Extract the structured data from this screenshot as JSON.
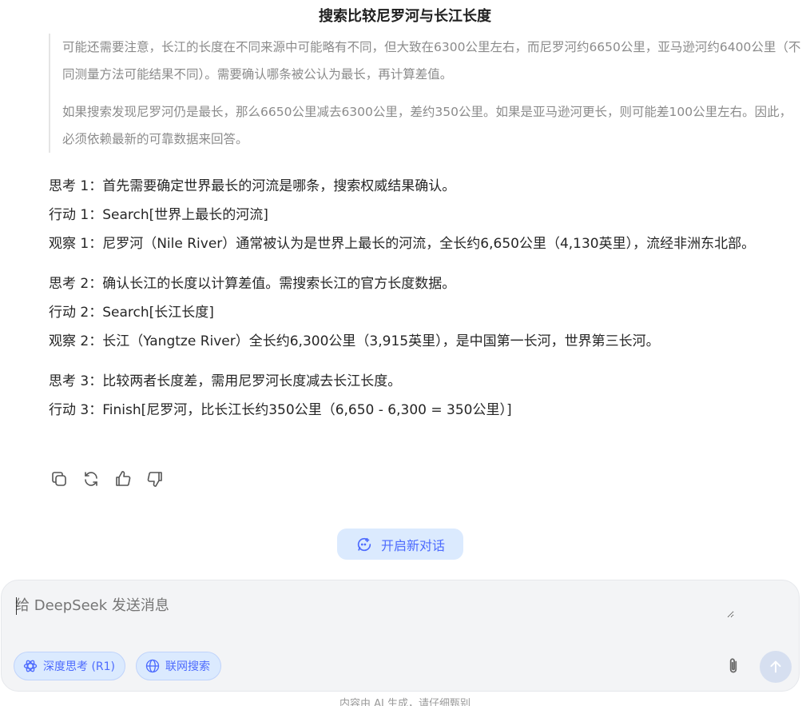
{
  "header": {
    "title": "搜索比较尼罗河与长江长度"
  },
  "thinking": {
    "paragraphs": [
      "可能还需要注意，长江的长度在不同来源中可能略有不同，但大致在6300公里左右，而尼罗河约6650公里，亚马逊河约6400公里（不同测量方法可能结果不同）。需要确认哪条被公认为最长，再计算差值。",
      "如果搜索发现尼罗河仍是最长，那么6650公里减去6300公里，差约350公里。如果是亚马逊河更长，则可能差100公里左右。因此，必须依赖最新的可靠数据来回答。"
    ]
  },
  "answer": {
    "group1": {
      "thought": "思考 1：首先需要确定世界最长的河流是哪条，搜索权威结果确认。",
      "action": "行动 1：Search[世界上最长的河流]",
      "observation": "观察 1：尼罗河（Nile River）通常被认为是世界上最长的河流，全长约6,650公里（4,130英里），流经非洲东北部。"
    },
    "group2": {
      "thought": "思考 2：确认长江的长度以计算差值。需搜索长江的官方长度数据。",
      "action": "行动 2：Search[长江长度]",
      "observation": "观察 2：长江（Yangtze River）全长约6,300公里（3,915英里），是中国第一长河，世界第三长河。"
    },
    "group3": {
      "thought": "思考 3：比较两者长度差，需用尼罗河长度减去长江长度。",
      "action": "行动 3：Finish[尼罗河，比长江长约350公里（6,650 - 6,300 = 350公里）]"
    }
  },
  "actions": {
    "icons": [
      "copy-icon",
      "regenerate-icon",
      "thumbs-up-icon",
      "thumbs-down-icon"
    ]
  },
  "new_chat": {
    "label": "开启新对话"
  },
  "composer": {
    "placeholder": "给 DeepSeek 发送消息",
    "deep_think_label": "深度思考 (R1)",
    "web_search_label": "联网搜索"
  },
  "footer": {
    "text": "内容由 AI 生成，请仔细甄别"
  },
  "colors": {
    "accent": "#4d6bfe",
    "chip_bg": "#dbeafe",
    "composer_bg": "#f3f4f6",
    "thinking_text": "#8b8b8b"
  }
}
